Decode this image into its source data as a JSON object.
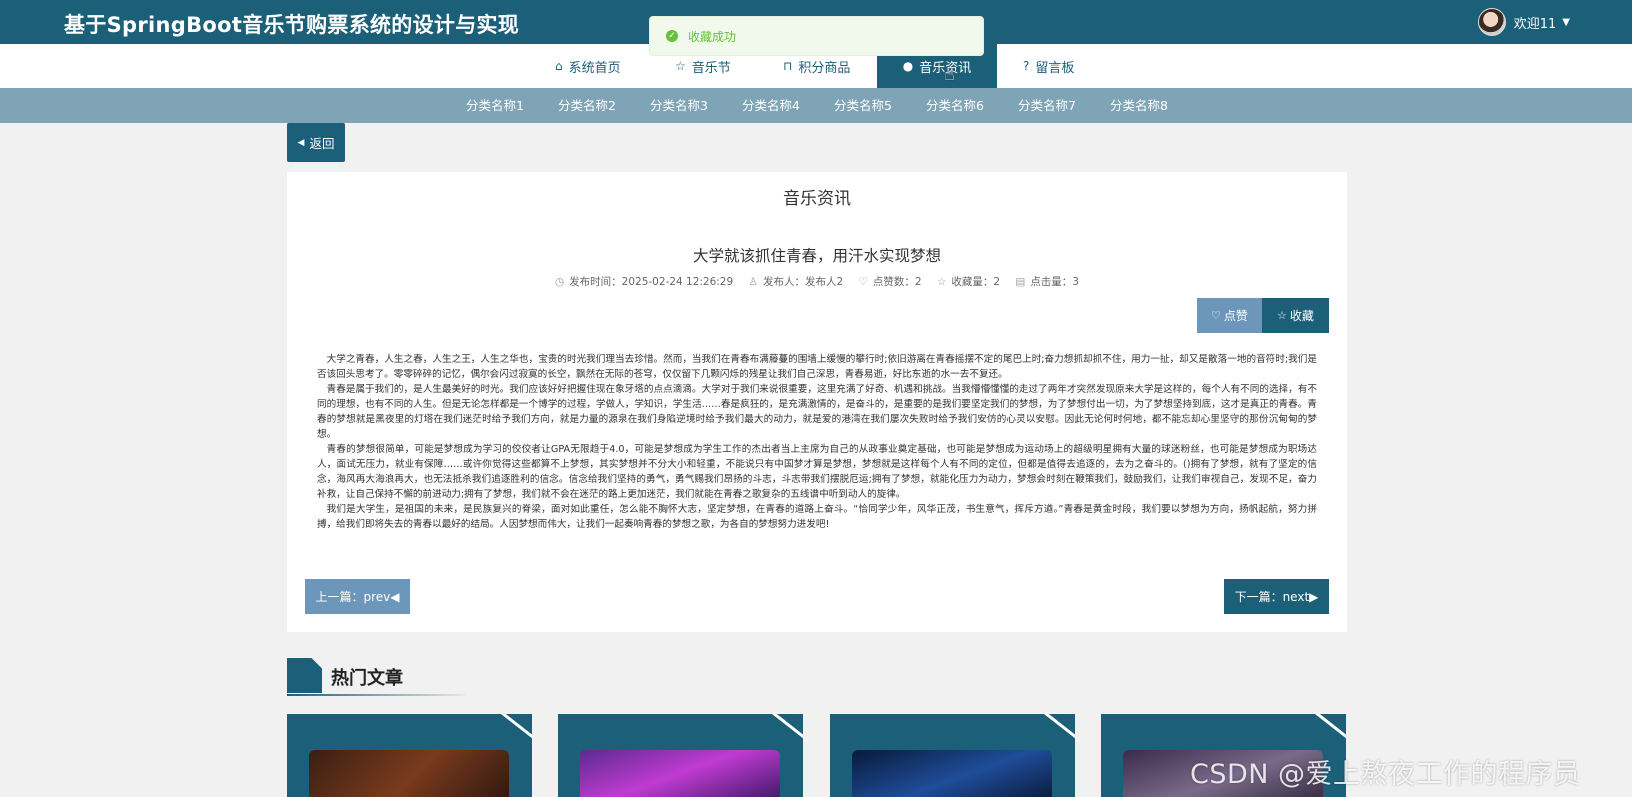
{
  "header": {
    "site_title": "基于SpringBoot音乐节购票系统的设计与实现",
    "user_label": "欢迎11",
    "user_icon": "avatar"
  },
  "toast": {
    "message": "收藏成功",
    "icon": "success-check-icon"
  },
  "main_nav": [
    {
      "label": "系统首页",
      "icon": "home-icon"
    },
    {
      "label": "音乐节",
      "icon": "star-icon"
    },
    {
      "label": "积分商品",
      "icon": "bag-icon"
    },
    {
      "label": "音乐资讯",
      "icon": "info-icon",
      "active": true
    },
    {
      "label": "留言板",
      "icon": "question-icon"
    }
  ],
  "categories": [
    "分类名称1",
    "分类名称2",
    "分类名称3",
    "分类名称4",
    "分类名称5",
    "分类名称6",
    "分类名称7",
    "分类名称8"
  ],
  "back_label": "返回",
  "article": {
    "section": "音乐资讯",
    "title": "大学就该抓住青春，用汗水实现梦想",
    "publish_time": "发布时间：2025-02-24 12:26:29",
    "publisher": "发布人：发布人2",
    "likes": "点赞数：2",
    "favorites": "收藏量：2",
    "clicks": "点击量：3",
    "like_button": "点赞",
    "fav_button": "收藏",
    "paragraphs": [
      "大学之青春，人生之春，人生之王，人生之华也，宝贵的时光我们理当去珍惜。然而，当我们在青春布满藤蔓的围墙上缓慢的攀行时;依旧游离在青春摇摆不定的尾巴上时;奋力想抓却抓不住，用力一扯，却又是散落一地的音符时;我们是否该回头思考了。零零碎碎的记忆，偶尔会闪过寂寞的长空，飘然在无际的苍穹，仅仅留下几颗闪烁的残星让我们自己深思，青春易逝，好比东逝的水一去不复还。",
      "青春是属于我们的，是人生最美好的时光。我们应该好好把握住现在象牙塔的点点滴滴。大学对于我们来说很重要，这里充满了好奇、机遇和挑战。当我懵懵懂懂的走过了两年才突然发现原来大学是这样的，每个人有不同的选择，有不同的理想，也有不同的人生。但是无论怎样都是一个博学的过程，学做人，学知识，学生活……春是疯狂的，是充满激情的，是奋斗的，是重要的是我们要坚定我们的梦想，为了梦想付出一切，为了梦想坚持到底，这才是真正的青春。青春的梦想就是黑夜里的灯塔在我们迷茫时给予我们方向，就是力量的源泉在我们身陷逆境时给予我们最大的动力，就是爱的港湾在我们屡次失败时给予我们安仿的心灵以安慰。因此无论何时何地，都不能忘却心里坚守的那份沉甸甸的梦想。",
      "青春的梦想很简单，可能是梦想成为学习的佼佼者让GPA无限趋于4.0，可能是梦想成为学生工作的杰出者当上主席为自己的从政事业奠定基础，也可能是梦想成为运动场上的超级明星拥有大量的球迷粉丝，也可能是梦想成为职场达人，面试无压力，就业有保障……或许你觉得这些都算不上梦想，其实梦想并不分大小和轻重，不能说只有中国梦才算是梦想，梦想就是这样每个人有不同的定位，但都是值得去追逐的，去为之奋斗的。()拥有了梦想，就有了坚定的信念，海风再大海浪再大，也无法抵杀我们追逐胜利的信念。信念给我们坚持的勇气，勇气赐我们昂扬的斗志，斗志带我们摆脱厄运;拥有了梦想，就能化压力为动力，梦想会时刻在鞭策我们，鼓励我们，让我们审视自己，发现不足，奋力补救，让自己保持不懈的前进动力;拥有了梦想，我们就不会在迷茫的路上更加迷茫，我们就能在青春之歌复杂的五线谱中听到动人的旋律。",
      "我们是大学生，是祖国的未来，是民族复兴的脊梁，面对如此重任，怎么能不胸怀大志，坚定梦想，在青春的道路上奋斗。“恰同学少年，风华正茂，书生意气，挥斥方遒。”青春是黄金时段，我们要以梦想为方向，扬帆起航，努力拼搏，给我们即将失去的青春以最好的结局。人因梦想而伟大，让我们一起奏响青春的梦想之歌，为各自的梦想努力进发吧!"
    ],
    "prev_label": "上一篇：prev◀",
    "next_label": "下一篇：next▶"
  },
  "hot": {
    "title": "热门文章"
  },
  "watermark": "CSDN @爱上熬夜工作的程序员"
}
